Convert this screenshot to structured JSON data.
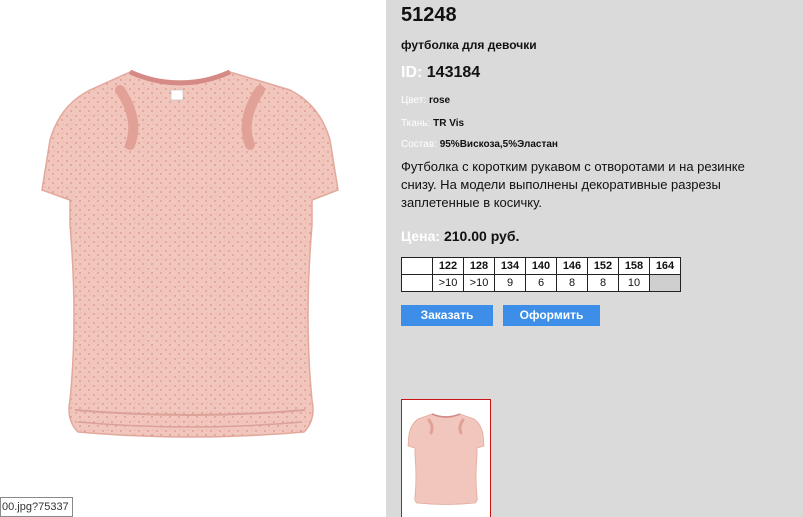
{
  "product": {
    "code": "51248",
    "subtitle": "футболка для девочки",
    "id_label": "ID:",
    "id_value": "143184",
    "color_label": "Цвет:",
    "color_value": "rose",
    "fabric_label": "Ткань:",
    "fabric_value": "TR Vis",
    "composition_label": "Состав:",
    "composition_value": "95%Вискоза,5%Эластан",
    "description": "Футболка с коротким рукавом с отворотами и на резинке снизу. На модели выполнены декоративные разрезы заплетенные в косичку.",
    "price_label": "Цена:",
    "price_value": "210.00 руб."
  },
  "sizes": {
    "headers": [
      "",
      "122",
      "128",
      "134",
      "140",
      "146",
      "152",
      "158",
      "164"
    ],
    "values": [
      "",
      ">10",
      ">10",
      "9",
      "6",
      "8",
      "8",
      "10",
      ""
    ]
  },
  "buttons": {
    "order": "Заказать",
    "checkout": "Оформить"
  },
  "tooltip": {
    "url": "00.jpg?75337"
  },
  "colors": {
    "panel_bg": "#dadada",
    "button_bg": "#3d8ee8",
    "thumb_border": "#c81414",
    "shirt": "#f1c7bd"
  },
  "icons": {
    "main_image": "pink-tshirt-image",
    "thumbnail": "pink-tshirt-thumbnail"
  }
}
